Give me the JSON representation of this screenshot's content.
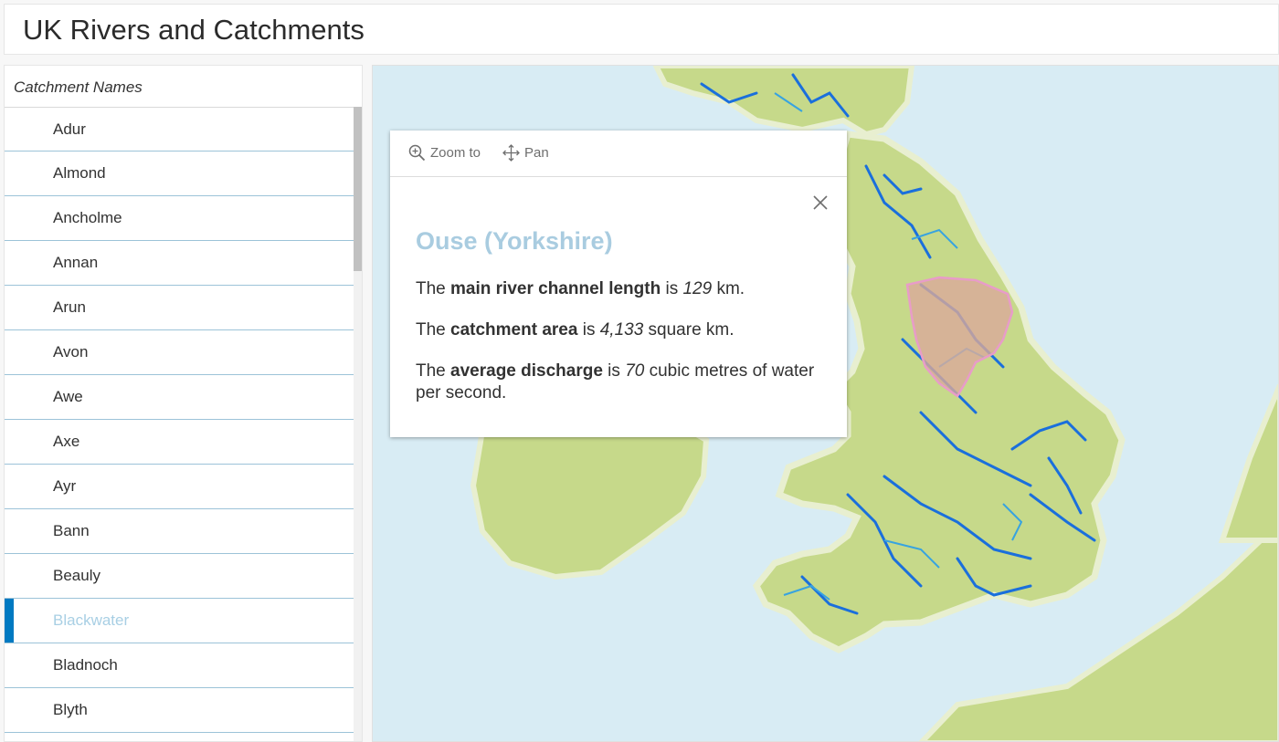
{
  "header": {
    "title": "UK Rivers and Catchments"
  },
  "sidebar": {
    "title": "Catchment Names",
    "items": [
      {
        "label": "Adur"
      },
      {
        "label": "Almond"
      },
      {
        "label": "Ancholme"
      },
      {
        "label": "Annan"
      },
      {
        "label": "Arun"
      },
      {
        "label": "Avon"
      },
      {
        "label": "Awe"
      },
      {
        "label": "Axe"
      },
      {
        "label": "Ayr"
      },
      {
        "label": "Bann"
      },
      {
        "label": "Beauly"
      },
      {
        "label": "Blackwater",
        "selected": true
      },
      {
        "label": "Bladnoch"
      },
      {
        "label": "Blyth"
      }
    ]
  },
  "popup": {
    "zoom_label": "Zoom to",
    "pan_label": "Pan",
    "title": "Ouse (Yorkshire)",
    "p1": {
      "pre": "The ",
      "bold": "main river channel length",
      "mid": " is ",
      "value": "129",
      "post": " km."
    },
    "p2": {
      "pre": "The ",
      "bold": "catchment area",
      "mid": " is ",
      "value": "4,133",
      "post": " square km."
    },
    "p3": {
      "pre": "The ",
      "bold": "average discharge",
      "mid": " is ",
      "value": "70",
      "post": " cubic metres of water per second."
    }
  },
  "colors": {
    "accent": "#0079c1",
    "selected_text": "#a8cfe4",
    "popup_title": "#a9cce0",
    "sea": "#d8ecf4",
    "land": "#c6d98a",
    "river": "#1a6fdc",
    "highlight_outline": "#e89cc8"
  },
  "icons": {
    "zoom": "zoom-in-icon",
    "pan": "pan-arrows-icon",
    "close": "close-icon"
  }
}
